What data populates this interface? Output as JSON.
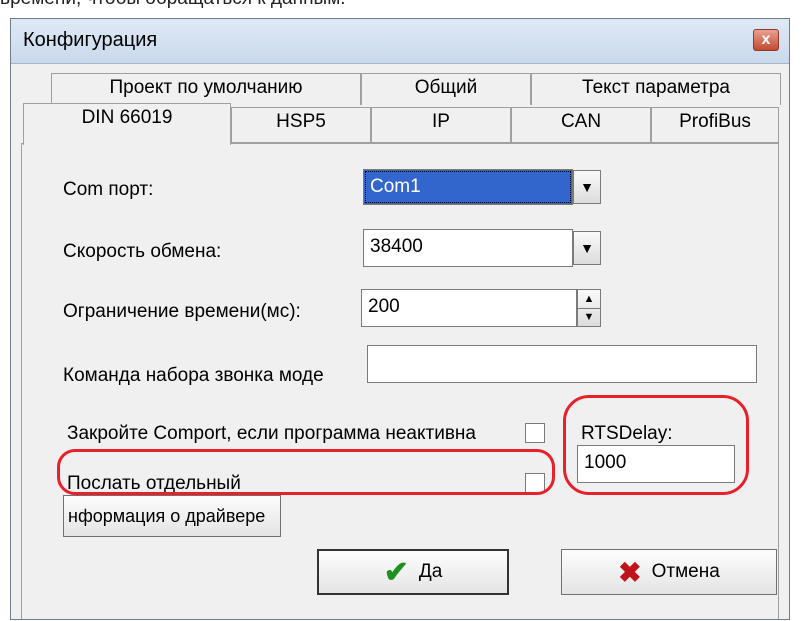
{
  "background_text": "времени, чтобы обращаться к данным.",
  "window": {
    "title": "Конфигурация",
    "close_glyph": "x"
  },
  "tabs": {
    "row1": [
      {
        "label": "Проект по умолчанию"
      },
      {
        "label": "Общий"
      },
      {
        "label": "Текст параметра"
      }
    ],
    "row2": [
      {
        "label": "DIN 66019",
        "active": true
      },
      {
        "label": "HSP5"
      },
      {
        "label": "IP"
      },
      {
        "label": "CAN"
      },
      {
        "label": "ProfiBus"
      }
    ]
  },
  "form": {
    "com_port": {
      "label": "Com порт:",
      "value": "Com1"
    },
    "baud_rate": {
      "label": "Скорость обмена:",
      "value": "38400"
    },
    "timeout": {
      "label": "Ограничение времени(мс):",
      "value": "200"
    },
    "modem_command": {
      "label": "Команда набора звонка моде",
      "value": ""
    },
    "close_comport": {
      "label": "Закройте Comport, если программа неактивна",
      "checked": false
    },
    "send_separate": {
      "label": "Послать отдельный",
      "checked": false
    },
    "rts_delay": {
      "label": "RTSDelay:",
      "value": "1000"
    },
    "driver_info_button": "нформация о драйвере"
  },
  "buttons": {
    "ok": "Да",
    "cancel": "Отмена"
  },
  "icons": {
    "dropdown": "▼",
    "spin_up": "▲",
    "spin_down": "▼",
    "ok": "✔",
    "cancel": "✖"
  },
  "colors": {
    "highlight_ring": "#e8202a",
    "selection": "#3366cc"
  }
}
